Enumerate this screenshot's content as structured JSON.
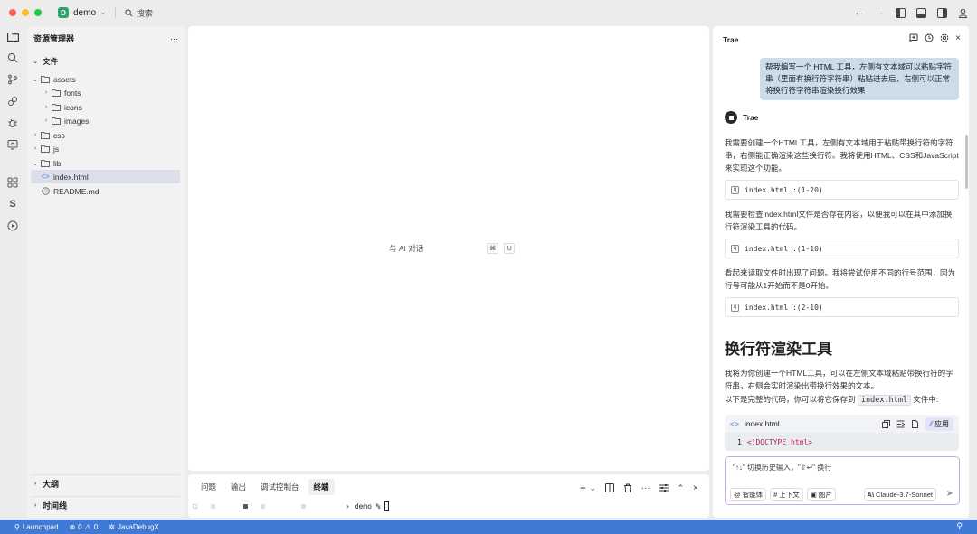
{
  "titlebar": {
    "project_initial": "D",
    "project_name": "demo",
    "search_label": "搜索",
    "colors": {
      "close": "#fe5f57",
      "minimize": "#febc2e",
      "maximize": "#28c840",
      "badge": "#2fa36b"
    }
  },
  "explorer": {
    "title": "资源管理器",
    "more": "···",
    "section": "文件",
    "items": [
      {
        "label": "assets",
        "kind": "folder",
        "open": true,
        "depth": 0
      },
      {
        "label": "fonts",
        "kind": "folder",
        "open": false,
        "depth": 1
      },
      {
        "label": "icons",
        "kind": "folder",
        "open": false,
        "depth": 1
      },
      {
        "label": "images",
        "kind": "folder",
        "open": false,
        "depth": 1
      },
      {
        "label": "css",
        "kind": "folder",
        "open": false,
        "depth": 0
      },
      {
        "label": "js",
        "kind": "folder",
        "open": false,
        "depth": 0
      },
      {
        "label": "lib",
        "kind": "folder",
        "open": true,
        "depth": 0
      },
      {
        "label": "index.html",
        "kind": "html",
        "selected": true,
        "depth": 0
      },
      {
        "label": "README.md",
        "kind": "info",
        "depth": 0
      }
    ],
    "outline": "大纲",
    "timeline": "时间线"
  },
  "editor": {
    "hint": "与 AI 对话",
    "key1": "⌘",
    "key2": "U"
  },
  "panel": {
    "tabs": [
      "问题",
      "输出",
      "调试控制台",
      "终端"
    ],
    "active_tab": "终端",
    "prompt": "› demo % "
  },
  "chat": {
    "title": "Trae",
    "user_message": "帮我编写一个 HTML 工具，左侧有文本域可以粘贴字符串（里面有换行符字符串）粘贴进去后，右侧可以正常将换行符字符串渲染换行效果",
    "assistant_name": "Trae",
    "p1": "我需要创建一个HTML工具，左侧有文本域用于粘贴带换行符的字符串，右侧能正确渲染这些换行符。我将使用HTML、CSS和JavaScript来实现这个功能。",
    "ref1": "index.html :(1-20)",
    "p2": "我需要检查index.html文件是否存在内容，以便我可以在其中添加换行符渲染工具的代码。",
    "ref2": "index.html :(1-10)",
    "p3": "看起来读取文件时出现了问题。我将尝试使用不同的行号范围，因为行号可能从1开始而不是0开始。",
    "ref3": "index.html :(2-10)",
    "heading": "换行符渲染工具",
    "p4": "我将为你创建一个HTML工具，可以在左侧文本域粘贴带换行符的字符串，右侧会实时渲染出带换行效果的文本。",
    "p5_before": "以下是完整的代码，你可以将它保存到 ",
    "p5_code": "index.html",
    "p5_after": " 文件中:",
    "code_file": "index.html",
    "apply": "应用",
    "code_line_no": "1",
    "code_line_a": "<!DOCTYPE ",
    "code_line_b": "html",
    "code_line_c": ">",
    "input_placeholder": "\"↑↓\" 切换历史输入，\"⇧↩\" 换行",
    "chip_agent": "智能体",
    "chip_context": "上下文",
    "chip_image": "图片",
    "model": "Claude-3.7-Sonnet"
  },
  "status": {
    "launchpad": "Launchpad",
    "errors": "0",
    "warnings": "0",
    "debug": "JavaDebugX"
  }
}
